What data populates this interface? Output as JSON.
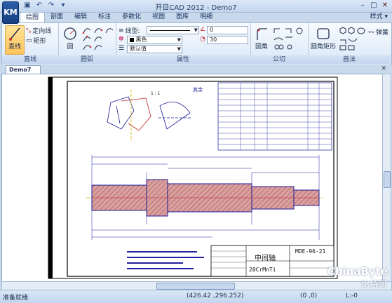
{
  "app": {
    "logo_text": "KM",
    "title": "开目CAD 2012 - Demo7"
  },
  "quick_access": [
    "new-doc-icon",
    "save-icon",
    "undo-icon",
    "redo-icon",
    "qat-dropdown-icon"
  ],
  "ribbon_tabs": [
    "绘图",
    "剖面",
    "编辑",
    "标注",
    "参数化",
    "视图",
    "图库",
    "明细"
  ],
  "active_tab": "绘图",
  "style_menu": "样式",
  "groups": {
    "line": {
      "label": "直线",
      "line_button": "直线",
      "fixed_dir": "定向线",
      "rect": "矩形"
    },
    "arc": {
      "label": "圆弧",
      "circle_button": "圆"
    },
    "props": {
      "label": "属性",
      "linetype_label": "线型:",
      "color_value": "黑色",
      "default_value": "默认值",
      "field1": "0",
      "field2": "30"
    },
    "common": {
      "label": "公切",
      "fillet_button": "圆角"
    },
    "draw": {
      "label": "画法",
      "round_rect_button": "圆角矩形",
      "spring_label": "弹簧"
    }
  },
  "document_tab": "Demo7",
  "drawing": {
    "title_part": "中间轴",
    "drawing_no": "MDE-96-21",
    "material": "20CrMnTi",
    "roughness_note": "其余",
    "section_label": "1 : 1"
  },
  "status": {
    "ready": "准备就绪",
    "coords": "(426.42 ,296.252)",
    "origin": "(0 ,0)",
    "layer": "L:-0"
  },
  "watermark": {
    "line1": "ChinaByte",
    "line2": "比特网"
  }
}
